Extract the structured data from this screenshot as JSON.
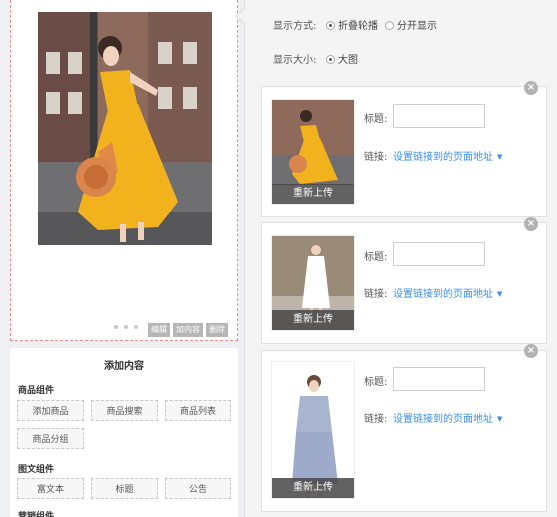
{
  "preview": {
    "actions": [
      "编辑",
      "加内容",
      "删除"
    ]
  },
  "add_panel": {
    "title": "添加内容",
    "groups": [
      {
        "title": "商品组件",
        "items": [
          "添加商品",
          "商品搜索",
          "商品列表",
          "商品分组"
        ]
      },
      {
        "title": "图文组件",
        "items": [
          "富文本",
          "标题",
          "公告"
        ]
      },
      {
        "title": "营销组件"
      }
    ]
  },
  "settings": {
    "display_mode_label": "显示方式:",
    "display_mode_options": [
      "折叠轮播",
      "分开显示"
    ],
    "display_mode_selected": "折叠轮播",
    "display_size_label": "显示大小:",
    "display_size_options": [
      "大图"
    ],
    "display_size_selected": "大图"
  },
  "cards": [
    {
      "title_label": "标题:",
      "title_value": "",
      "link_label": "链接:",
      "link_text": "设置链接到的页面地址",
      "reupload": "重新上传"
    },
    {
      "title_label": "标题:",
      "title_value": "",
      "link_label": "链接:",
      "link_text": "设置链接到的页面地址",
      "reupload": "重新上传"
    },
    {
      "title_label": "标题:",
      "title_value": "",
      "link_label": "链接:",
      "link_text": "设置链接到的页面地址",
      "reupload": "重新上传"
    }
  ],
  "colors": {
    "link": "#3a8ee6",
    "dashed_border": "#f08c8c",
    "dress_yellow": "#f2b21e"
  },
  "icons": {
    "close": "close-icon",
    "chevron": "chevron-down-icon"
  }
}
